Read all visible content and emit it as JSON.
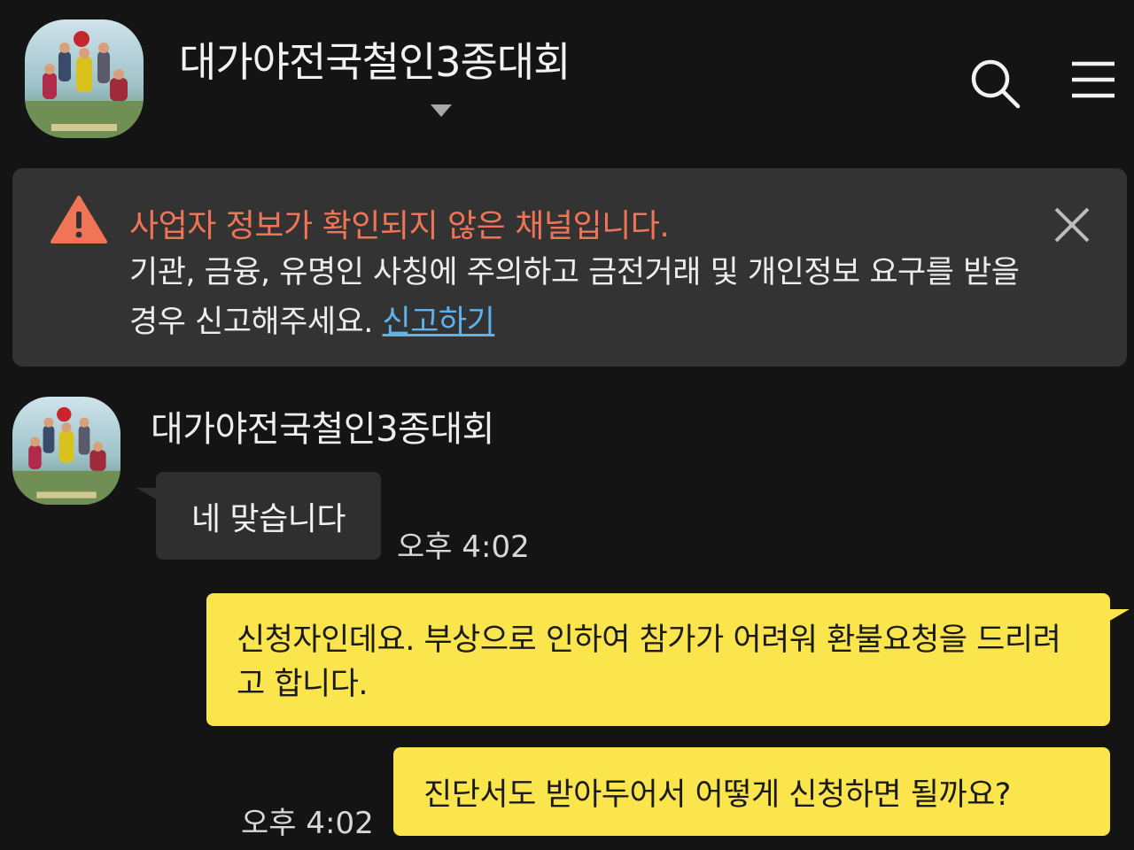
{
  "header": {
    "channel_title": "대가야전국철인3종대회",
    "avatar_icon": "channel-profile-photo",
    "search_icon": "search-icon",
    "menu_icon": "hamburger-menu-icon"
  },
  "warning": {
    "title": "사업자 정보가 확인되지 않은 채널입니다.",
    "body": "기관, 금융, 유명인 사칭에 주의하고 금전거래 및 개인정보 요구를 받을 경우 신고해주세요.",
    "link": "신고하기",
    "title_color": "#f07456",
    "link_color": "#5eb3ec"
  },
  "messages": [
    {
      "direction": "incoming",
      "sender": "대가야전국철인3종대회",
      "text": "네 맞습니다",
      "time": "오후 4:02"
    },
    {
      "direction": "outgoing",
      "text": "신청자인데요. 부상으로 인하여 참가가 어려워 환불요청을 드리려고 합니다."
    },
    {
      "direction": "outgoing",
      "text": "진단서도 받아두어서 어떻게 신청하면 될까요?",
      "time": "오후 4:02"
    }
  ],
  "colors": {
    "background": "#141414",
    "banner": "#333333",
    "incoming_bubble": "#2f2f2f",
    "outgoing_bubble": "#fae54c"
  }
}
